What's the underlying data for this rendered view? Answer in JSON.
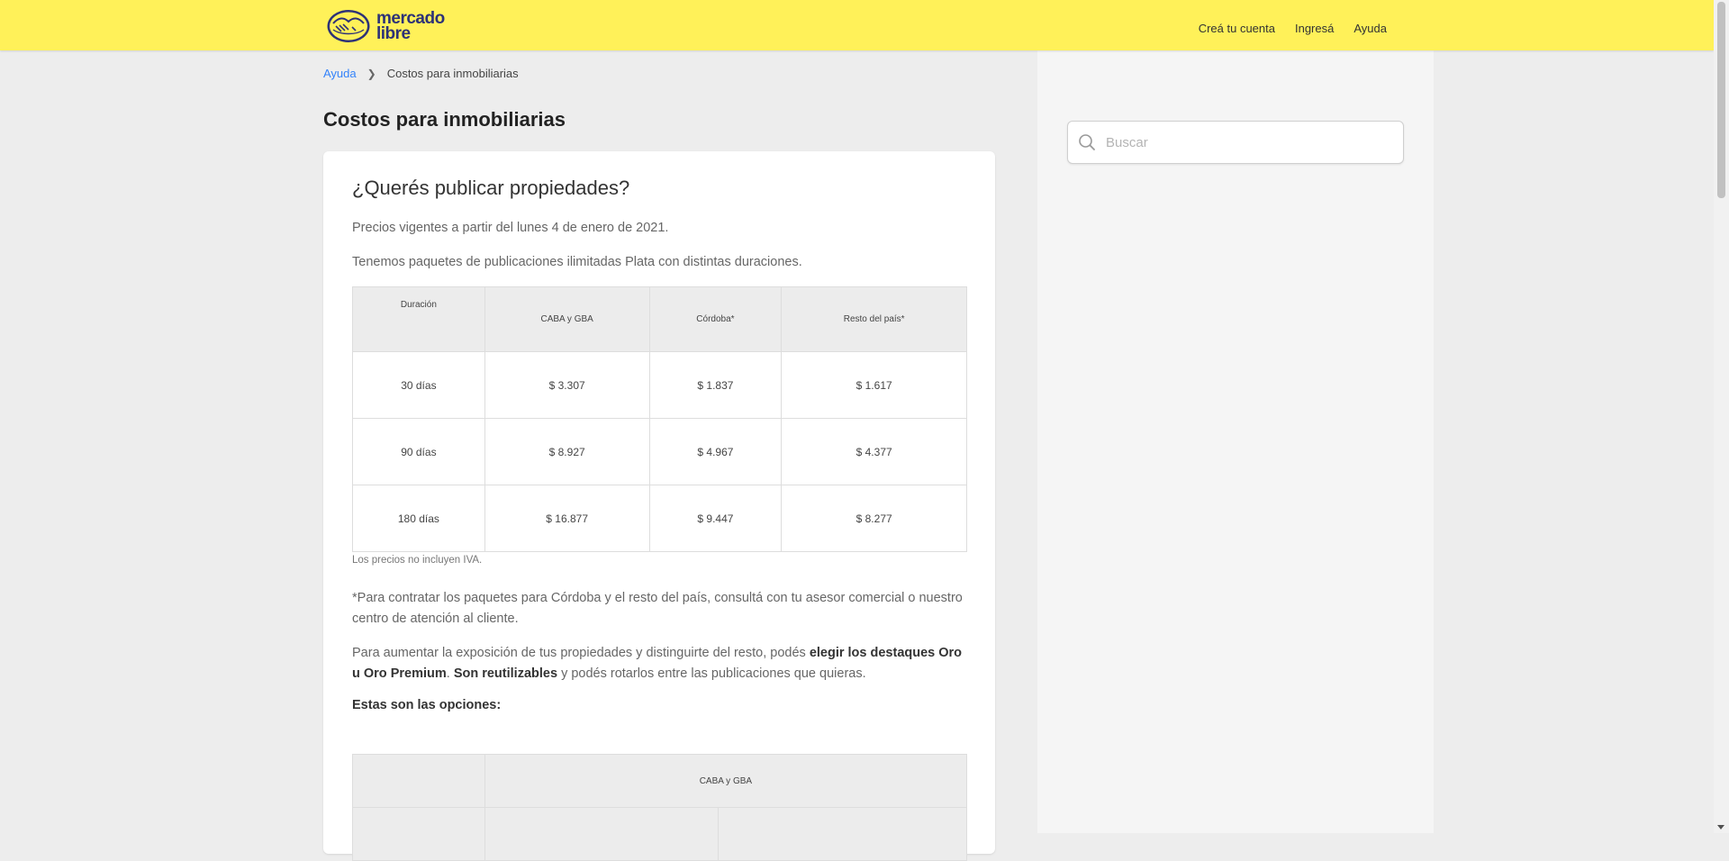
{
  "header": {
    "logo_line1": "mercado",
    "logo_line2": "libre",
    "nav": [
      "Creá tu cuenta",
      "Ingresá",
      "Ayuda"
    ]
  },
  "breadcrumb": {
    "root": "Ayuda",
    "current": "Costos para inmobiliarias"
  },
  "page_title": "Costos para inmobiliarias",
  "article": {
    "heading": "¿Querés publicar propiedades?",
    "p1": "Precios vigentes a partir del lunes 4 de enero de 2021.",
    "p2": "Tenemos paquetes de publicaciones ilimitadas Plata con distintas duraciones.",
    "table": {
      "headers": [
        "Duración",
        "CABA y GBA",
        "Córdoba*",
        "Resto del país*"
      ],
      "rows": [
        [
          "30 días",
          "$ 3.307",
          "$ 1.837",
          "$ 1.617"
        ],
        [
          "90 días",
          "$ 8.927",
          "$ 4.967",
          "$ 4.377"
        ],
        [
          "180 días",
          "$ 16.877",
          "$ 9.447",
          "$ 8.277"
        ]
      ]
    },
    "note": "Los precios no incluyen IVA.",
    "p3": "*Para contratar los paquetes para Córdoba y el resto del país, consultá con tu asesor comercial o nuestro centro de atención al cliente.",
    "p4": {
      "t1": "Para aumentar la exposición de tus propiedades y distinguirte del resto, podés ",
      "b1": "elegir los destaques Oro u Oro Premium",
      "t2": ". ",
      "b2": "Son reutilizables",
      "t3": " y podés rotarlos entre las publicaciones que quieras."
    },
    "options_label": "Estas son las opciones:",
    "options_table_header": "CABA y GBA"
  },
  "search": {
    "placeholder": "Buscar"
  },
  "colors": {
    "header_bg": "#fff159",
    "link": "#3483fa",
    "logo": "#2d3277"
  }
}
